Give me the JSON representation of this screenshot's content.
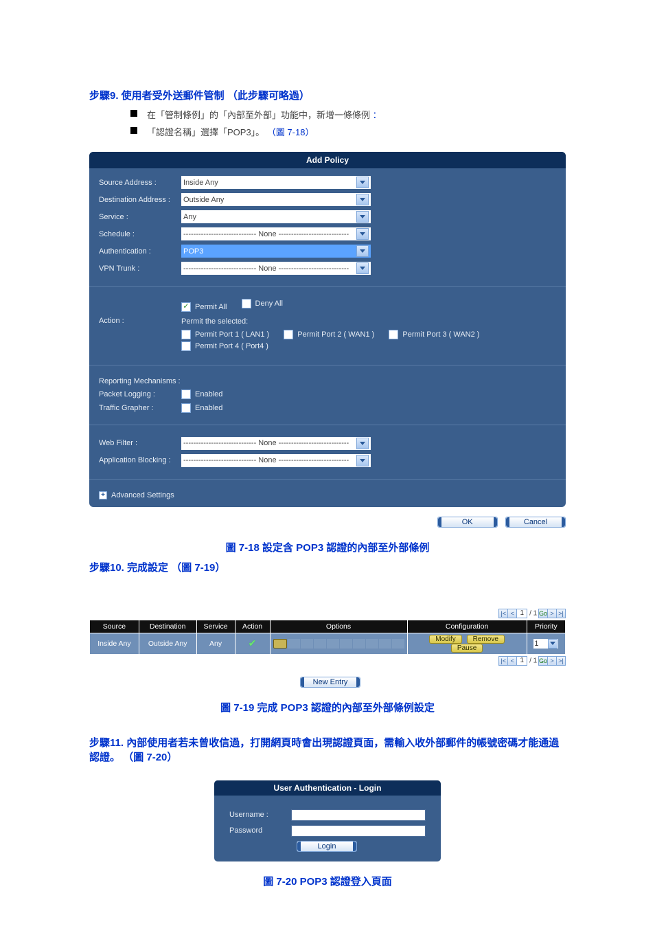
{
  "headings": {
    "h1_step9": "步驟9.  使用者受外送郵件管制",
    "h1_step9_paren": "（此步驟可略過）",
    "bullet1_prefix": "在「管制條例」的「內部至外部」功能中，新增一條條例",
    "bullet1_colon": "：",
    "bullet2_prefix": "「認證名稱」選擇「POP3」。",
    "bullet2_paren": "（圖 7-18）",
    "h1_fig18": "圖 7-18 設定含 POP3 認證的內部至外部條例",
    "h1_step10": "步驟10.  完成設定",
    "h1_step10_paren": "（圖 7-19）",
    "h1_fig19": "圖 7-19 完成 POP3 認證的內部至外部條例設定",
    "h1_step11": "步驟11.  內部使用者若未曾收信過，打開網頁時會出現認證頁面，需輸入收外部郵件的帳號密碼才能通過認證。",
    "h1_step11_paren": "（圖 7-20）",
    "h1_fig20": "圖 7-20 POP3 認證登入頁面"
  },
  "add_policy": {
    "title": "Add Policy",
    "labels": {
      "source": "Source Address :",
      "dest": "Destination Address :",
      "service": "Service :",
      "schedule": "Schedule :",
      "auth": "Authentication :",
      "vpn": "VPN Trunk :",
      "action": "Action :",
      "reporting": "Reporting Mechanisms :",
      "packet_logging": "Packet Logging :",
      "traffic_grapher": "Traffic Grapher :",
      "web_filter": "Web Filter :",
      "app_block": "Application Blocking :",
      "advanced": "Advanced Settings"
    },
    "values": {
      "source": "Inside Any",
      "dest": "Outside Any",
      "service": "Any",
      "none_dashes": "----------------------------- None ----------------------------",
      "auth": "POP3"
    },
    "action": {
      "permit_all": "Permit All",
      "deny_all": "Deny All",
      "permit_selected": "Permit the selected:",
      "p1": "Permit Port  1  ( LAN1 )",
      "p2": "Permit Port  2  ( WAN1 )",
      "p3": "Permit Port  3  ( WAN2 )",
      "p4": "Permit Port  4  ( Port4 )"
    },
    "enabled": "Enabled",
    "ok": "OK",
    "cancel": "Cancel"
  },
  "table": {
    "headers": {
      "source": "Source",
      "dest": "Destination",
      "service": "Service",
      "action": "Action",
      "options": "Options",
      "config": "Configuration",
      "priority": "Priority"
    },
    "row": {
      "source": "Inside Any",
      "dest": "Outside Any",
      "service": "Any"
    },
    "buttons": {
      "modify": "Modify",
      "remove": "Remove",
      "pause": "Pause"
    },
    "priority_value": "1",
    "pager_page": "1",
    "pager_total": "1",
    "new_entry": "New Entry"
  },
  "login": {
    "title": "User Authentication - Login",
    "username": "Username :",
    "password": "Password",
    "button": "Login"
  }
}
